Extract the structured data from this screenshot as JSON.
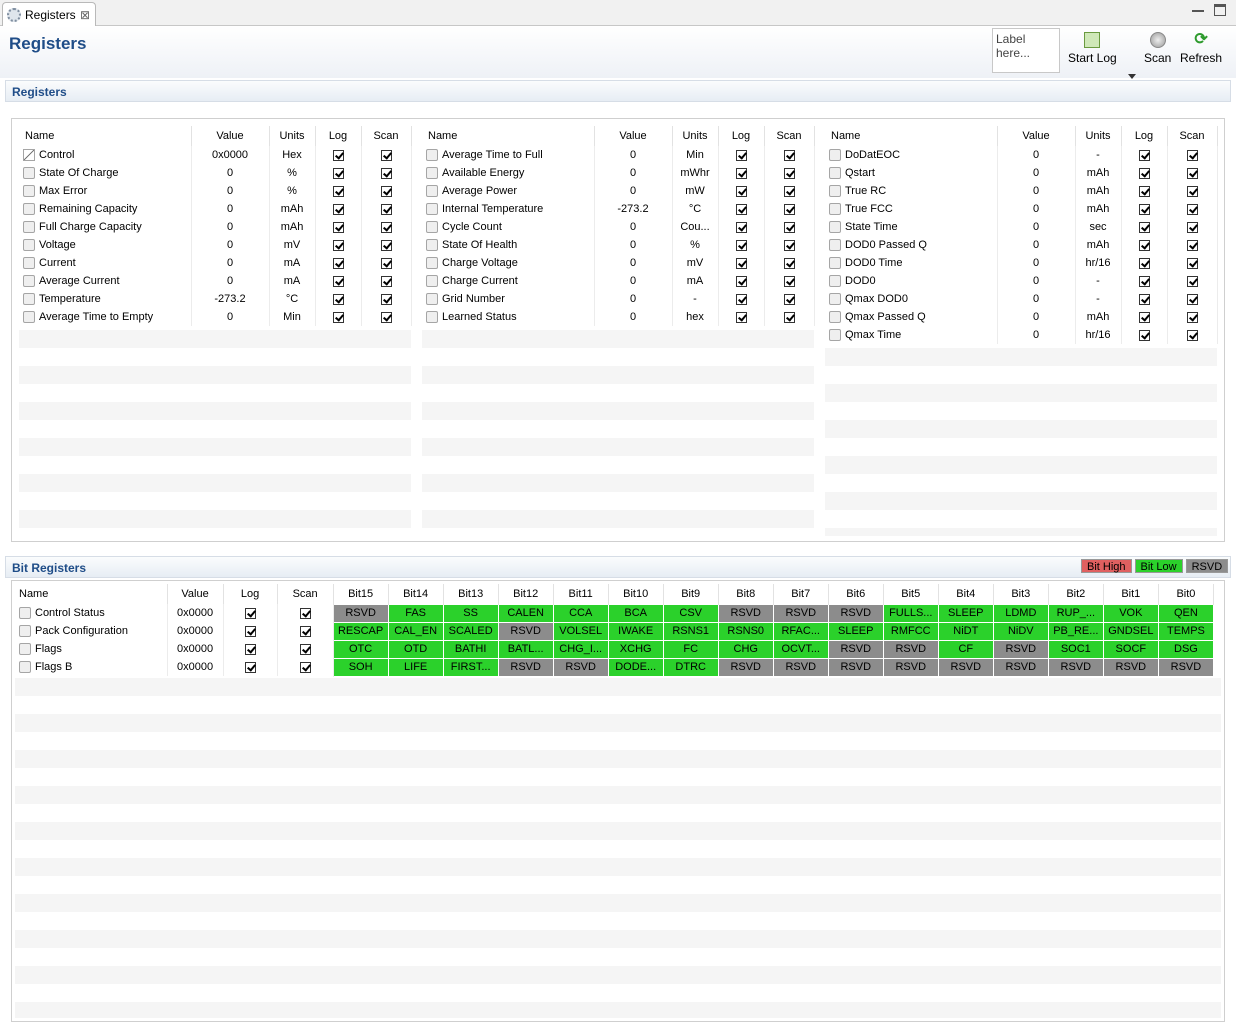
{
  "tab": {
    "label": "Registers",
    "close": "⊠"
  },
  "header": {
    "title": "Registers",
    "label_placeholder": "Label here...",
    "start_log": "Start Log",
    "scan": "Scan",
    "refresh": "Refresh"
  },
  "registers_section": {
    "title": "Registers",
    "columns": [
      "Name",
      "Value",
      "Units",
      "Log",
      "Scan"
    ],
    "tables": [
      {
        "rows": [
          {
            "name": "Control",
            "value": "0x0000",
            "units": "Hex",
            "icon": "pencil-icon"
          },
          {
            "name": "State Of Charge",
            "value": "0",
            "units": "%",
            "icon": "lock-icon"
          },
          {
            "name": "Max Error",
            "value": "0",
            "units": "%",
            "icon": "lock-icon"
          },
          {
            "name": "Remaining Capacity",
            "value": "0",
            "units": "mAh",
            "icon": "lock-icon"
          },
          {
            "name": "Full Charge Capacity",
            "value": "0",
            "units": "mAh",
            "icon": "lock-icon"
          },
          {
            "name": "Voltage",
            "value": "0",
            "units": "mV",
            "icon": "lock-icon"
          },
          {
            "name": "Current",
            "value": "0",
            "units": "mA",
            "icon": "lock-icon"
          },
          {
            "name": "Average Current",
            "value": "0",
            "units": "mA",
            "icon": "lock-icon"
          },
          {
            "name": "Temperature",
            "value": "-273.2",
            "units": "°C",
            "icon": "lock-icon"
          },
          {
            "name": "Average Time to Empty",
            "value": "0",
            "units": "Min",
            "icon": "lock-icon"
          }
        ]
      },
      {
        "rows": [
          {
            "name": "Average Time to Full",
            "value": "0",
            "units": "Min",
            "icon": "lock-icon"
          },
          {
            "name": "Available Energy",
            "value": "0",
            "units": "mWhr",
            "icon": "lock-icon"
          },
          {
            "name": "Average Power",
            "value": "0",
            "units": "mW",
            "icon": "lock-icon"
          },
          {
            "name": "Internal Temperature",
            "value": "-273.2",
            "units": "°C",
            "icon": "lock-icon"
          },
          {
            "name": "Cycle Count",
            "value": "0",
            "units": "Cou...",
            "icon": "lock-icon"
          },
          {
            "name": "State Of Health",
            "value": "0",
            "units": "%",
            "icon": "lock-icon"
          },
          {
            "name": "Charge Voltage",
            "value": "0",
            "units": "mV",
            "icon": "lock-icon"
          },
          {
            "name": "Charge Current",
            "value": "0",
            "units": "mA",
            "icon": "lock-icon"
          },
          {
            "name": "Grid Number",
            "value": "0",
            "units": "-",
            "icon": "lock-icon"
          },
          {
            "name": "Learned Status",
            "value": "0",
            "units": "hex",
            "icon": "lock-icon"
          }
        ]
      },
      {
        "rows": [
          {
            "name": "DoDatEOC",
            "value": "0",
            "units": "-",
            "icon": "lock-icon"
          },
          {
            "name": "Qstart",
            "value": "0",
            "units": "mAh",
            "icon": "lock-icon"
          },
          {
            "name": "True RC",
            "value": "0",
            "units": "mAh",
            "icon": "lock-icon"
          },
          {
            "name": "True FCC",
            "value": "0",
            "units": "mAh",
            "icon": "lock-icon"
          },
          {
            "name": "State Time",
            "value": "0",
            "units": "sec",
            "icon": "lock-icon"
          },
          {
            "name": "DOD0 Passed Q",
            "value": "0",
            "units": "mAh",
            "icon": "lock-icon"
          },
          {
            "name": "DOD0 Time",
            "value": "0",
            "units": "hr/16",
            "icon": "lock-icon"
          },
          {
            "name": "DOD0",
            "value": "0",
            "units": "-",
            "icon": "lock-icon"
          },
          {
            "name": "Qmax DOD0",
            "value": "0",
            "units": "-",
            "icon": "lock-icon"
          },
          {
            "name": "Qmax Passed Q",
            "value": "0",
            "units": "mAh",
            "icon": "lock-icon"
          },
          {
            "name": "Qmax Time",
            "value": "0",
            "units": "hr/16",
            "icon": "lock-icon"
          }
        ]
      }
    ]
  },
  "bit_section": {
    "title": "Bit Registers",
    "legend": {
      "high": "Bit High",
      "low": "Bit Low",
      "rsvd": "RSVD",
      "high_color": "#e06060",
      "low_color": "#2bd12b",
      "rsvd_color": "#8c8c8c"
    },
    "columns": [
      "Name",
      "Value",
      "Log",
      "Scan",
      "Bit15",
      "Bit14",
      "Bit13",
      "Bit12",
      "Bit11",
      "Bit10",
      "Bit9",
      "Bit8",
      "Bit7",
      "Bit6",
      "Bit5",
      "Bit4",
      "Bit3",
      "Bit2",
      "Bit1",
      "Bit0"
    ],
    "rows": [
      {
        "name": "Control Status",
        "value": "0x0000",
        "bits": [
          [
            "RSVD",
            "s"
          ],
          [
            "FAS",
            "g"
          ],
          [
            "SS",
            "g"
          ],
          [
            "CALEN",
            "g"
          ],
          [
            "CCA",
            "g"
          ],
          [
            "BCA",
            "g"
          ],
          [
            "CSV",
            "g"
          ],
          [
            "RSVD",
            "s"
          ],
          [
            "RSVD",
            "s"
          ],
          [
            "RSVD",
            "s"
          ],
          [
            "FULLS...",
            "g"
          ],
          [
            "SLEEP",
            "g"
          ],
          [
            "LDMD",
            "g"
          ],
          [
            "RUP_...",
            "g"
          ],
          [
            "VOK",
            "g"
          ],
          [
            "QEN",
            "g"
          ]
        ]
      },
      {
        "name": "Pack Configuration",
        "value": "0x0000",
        "bits": [
          [
            "RESCAP",
            "g"
          ],
          [
            "CAL_EN",
            "g"
          ],
          [
            "SCALED",
            "g"
          ],
          [
            "RSVD",
            "s"
          ],
          [
            "VOLSEL",
            "g"
          ],
          [
            "IWAKE",
            "g"
          ],
          [
            "RSNS1",
            "g"
          ],
          [
            "RSNS0",
            "g"
          ],
          [
            "RFAC...",
            "g"
          ],
          [
            "SLEEP",
            "g"
          ],
          [
            "RMFCC",
            "g"
          ],
          [
            "NiDT",
            "g"
          ],
          [
            "NiDV",
            "g"
          ],
          [
            "PB_RE...",
            "g"
          ],
          [
            "GNDSEL",
            "g"
          ],
          [
            "TEMPS",
            "g"
          ]
        ]
      },
      {
        "name": "Flags",
        "value": "0x0000",
        "bits": [
          [
            "OTC",
            "g"
          ],
          [
            "OTD",
            "g"
          ],
          [
            "BATHI",
            "g"
          ],
          [
            "BATL...",
            "g"
          ],
          [
            "CHG_I...",
            "g"
          ],
          [
            "XCHG",
            "g"
          ],
          [
            "FC",
            "g"
          ],
          [
            "CHG",
            "g"
          ],
          [
            "OCVT...",
            "g"
          ],
          [
            "RSVD",
            "s"
          ],
          [
            "RSVD",
            "s"
          ],
          [
            "CF",
            "g"
          ],
          [
            "RSVD",
            "s"
          ],
          [
            "SOC1",
            "g"
          ],
          [
            "SOCF",
            "g"
          ],
          [
            "DSG",
            "g"
          ]
        ]
      },
      {
        "name": "Flags B",
        "value": "0x0000",
        "bits": [
          [
            "SOH",
            "g"
          ],
          [
            "LIFE",
            "g"
          ],
          [
            "FIRST...",
            "g"
          ],
          [
            "RSVD",
            "s"
          ],
          [
            "RSVD",
            "s"
          ],
          [
            "DODE...",
            "g"
          ],
          [
            "DTRC",
            "g"
          ],
          [
            "RSVD",
            "s"
          ],
          [
            "RSVD",
            "s"
          ],
          [
            "RSVD",
            "s"
          ],
          [
            "RSVD",
            "s"
          ],
          [
            "RSVD",
            "s"
          ],
          [
            "RSVD",
            "s"
          ],
          [
            "RSVD",
            "s"
          ],
          [
            "RSVD",
            "s"
          ],
          [
            "RSVD",
            "s"
          ]
        ]
      }
    ]
  }
}
